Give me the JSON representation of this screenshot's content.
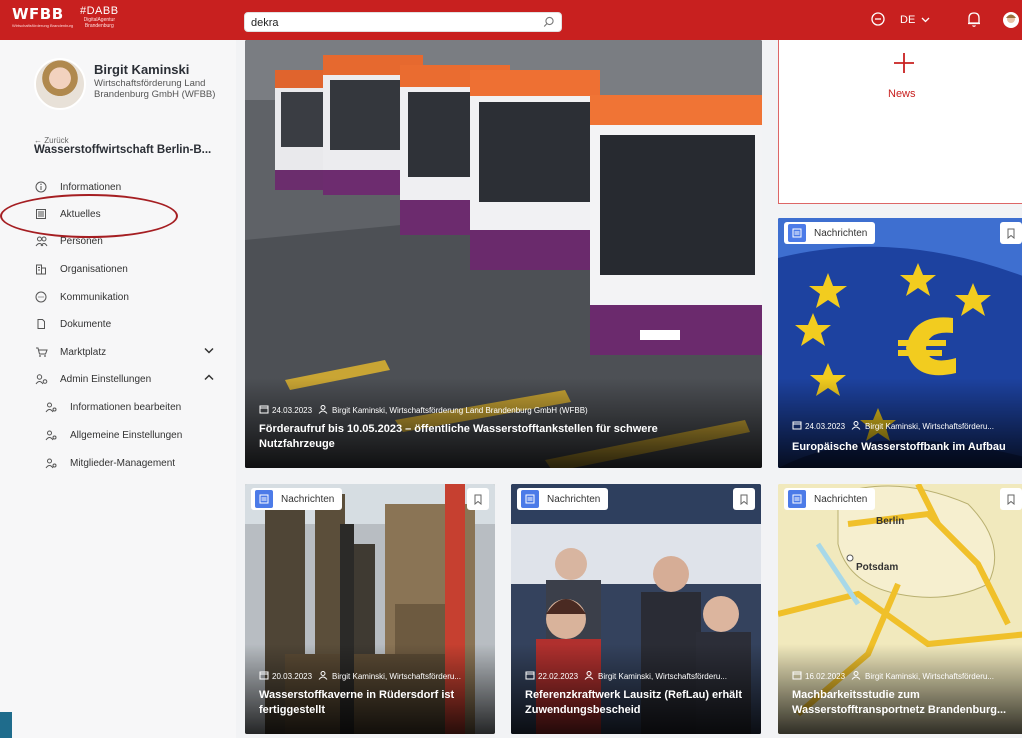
{
  "header": {
    "logo_text": "WFBB",
    "logo_sub": "Wirtschaftsförderung Brandenburg",
    "logo2_text": "#DABB",
    "logo2_sub_1": "DigitalAgentur",
    "logo2_sub_2": "Brandenburg",
    "search_value": "dekra",
    "language": "DE"
  },
  "sidebar": {
    "user_name": "Birgit Kaminski",
    "user_org": "Wirtschaftsförderung Land Brandenburg GmbH (WFBB)",
    "back_label": "Zurück",
    "breadcrumb": "Wasserstoffwirtschaft Berlin-B...",
    "items": [
      {
        "label": "Informationen",
        "icon": "info-icon"
      },
      {
        "label": "Aktuelles",
        "icon": "news-icon"
      },
      {
        "label": "Personen",
        "icon": "people-icon"
      },
      {
        "label": "Organisationen",
        "icon": "building-icon"
      },
      {
        "label": "Kommunikation",
        "icon": "chat-icon"
      },
      {
        "label": "Dokumente",
        "icon": "document-icon"
      },
      {
        "label": "Marktplatz",
        "icon": "cart-icon"
      },
      {
        "label": "Admin Einstellungen",
        "icon": "admin-icon"
      }
    ],
    "sub_items": [
      {
        "label": "Informationen bearbeiten"
      },
      {
        "label": "Allgemeine Einstellungen"
      },
      {
        "label": "Mitglieder-Management"
      }
    ]
  },
  "news_tile": {
    "label": "News"
  },
  "cards": {
    "featured": {
      "date": "24.03.2023",
      "author": "Birgit Kaminski, Wirtschaftsförderung Land Brandenburg GmbH (WFBB)",
      "title": "Förderaufruf bis 10.05.2023 – öffentliche Wasserstofftankstellen für schwere Nutzfahrzeuge"
    },
    "eu": {
      "category": "Nachrichten",
      "date": "24.03.2023",
      "author": "Birgit Kaminski, Wirtschaftsförderu...",
      "title": "Europäische Wasserstoffbank im Aufbau"
    },
    "kaverne": {
      "category": "Nachrichten",
      "date": "20.03.2023",
      "author": "Birgit Kaminski, Wirtschaftsförderu...",
      "title": "Wasserstoffkaverne in Rüdersdorf ist fertiggestellt"
    },
    "lausitz": {
      "category": "Nachrichten",
      "date": "22.02.2023",
      "author": "Birgit Kaminski, Wirtschaftsförderu...",
      "title": "Referenzkraftwerk Lausitz (RefLau) erhält Zuwendungsbescheid"
    },
    "studie": {
      "category": "Nachrichten",
      "date": "16.02.2023",
      "author": "Birgit Kaminski, Wirtschaftsförderu...",
      "title": "Machbarkeitsstudie zum Wasserstofftransportnetz Brandenburg...",
      "map_label_1": "Berlin",
      "map_label_2": "Potsdam"
    }
  },
  "colors": {
    "brand": "#c8201f",
    "badge_icon": "#4c7be8"
  }
}
